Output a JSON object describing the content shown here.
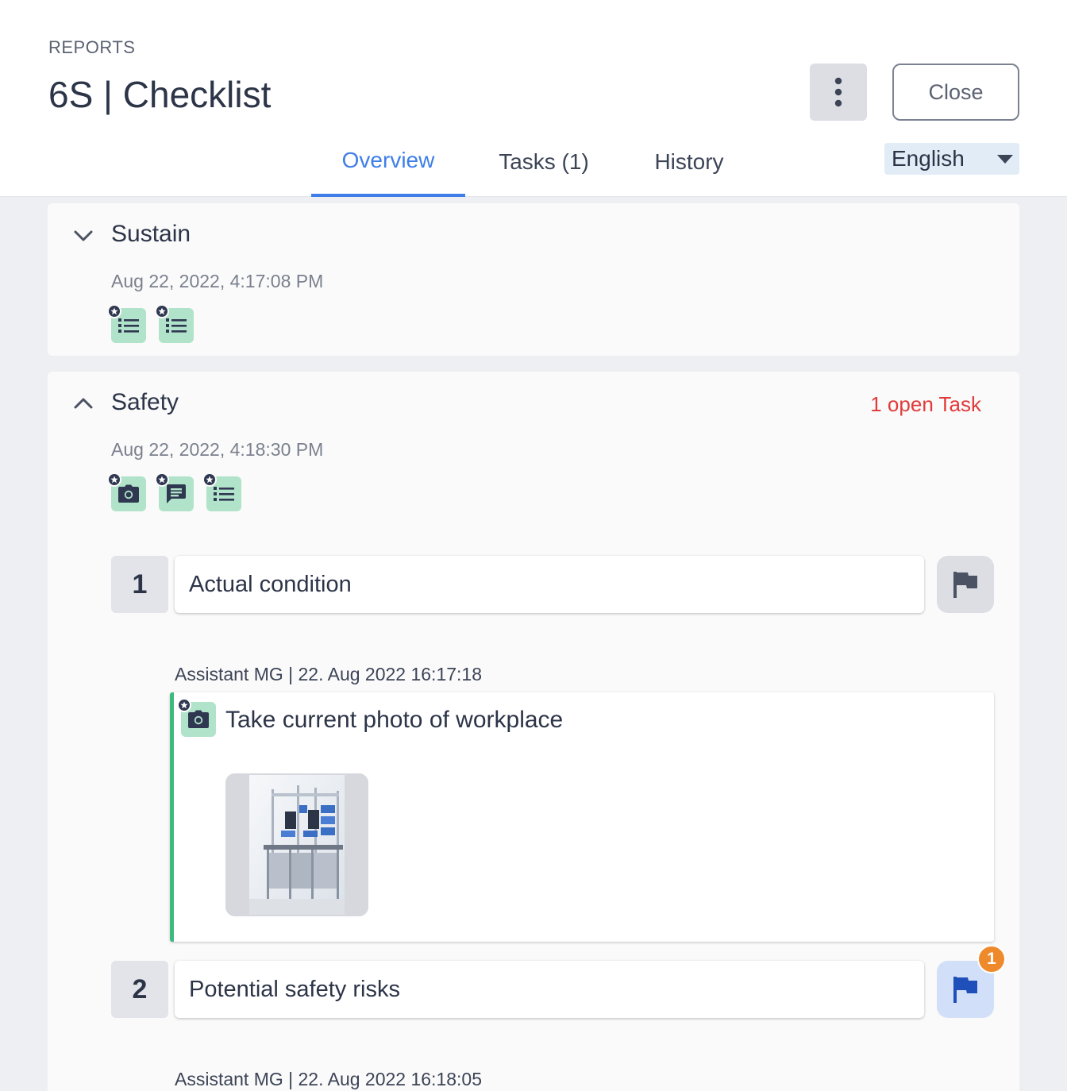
{
  "header": {
    "breadcrumb": "REPORTS",
    "title": "6S | Checklist",
    "close_label": "Close",
    "more_icon": "more-vertical-icon"
  },
  "tabs": [
    {
      "label": "Overview",
      "active": true
    },
    {
      "label": "Tasks (1)",
      "active": false
    },
    {
      "label": "History",
      "active": false
    }
  ],
  "language": {
    "selected": "English"
  },
  "sections": [
    {
      "title": "Sustain",
      "date": "Aug 22, 2022, 4:17:08 PM",
      "expanded": false,
      "icons": [
        "checklist-icon",
        "checklist-icon"
      ]
    },
    {
      "title": "Safety",
      "date": "Aug 22, 2022, 4:18:30 PM",
      "expanded": true,
      "open_tasks": "1 open Task",
      "icons": [
        "camera-icon",
        "comment-icon",
        "checklist-icon"
      ],
      "questions": [
        {
          "number": "1",
          "text": "Actual condition",
          "flag_state": "inactive",
          "answer_meta": "Assistant MG | 22. Aug 2022 16:17:18",
          "answer_text": "Take current photo of workplace",
          "answer_icon": "camera-icon"
        },
        {
          "number": "2",
          "text": "Potential safety risks",
          "flag_state": "active",
          "flag_count": "1",
          "answer_meta": "Assistant MG | 22. Aug 2022 16:18:05"
        }
      ]
    }
  ],
  "colors": {
    "accent": "#3f7ee8",
    "open_task": "#e23b3b",
    "answer_green": "#3fba7e",
    "badge_orange": "#ef8a2c"
  }
}
